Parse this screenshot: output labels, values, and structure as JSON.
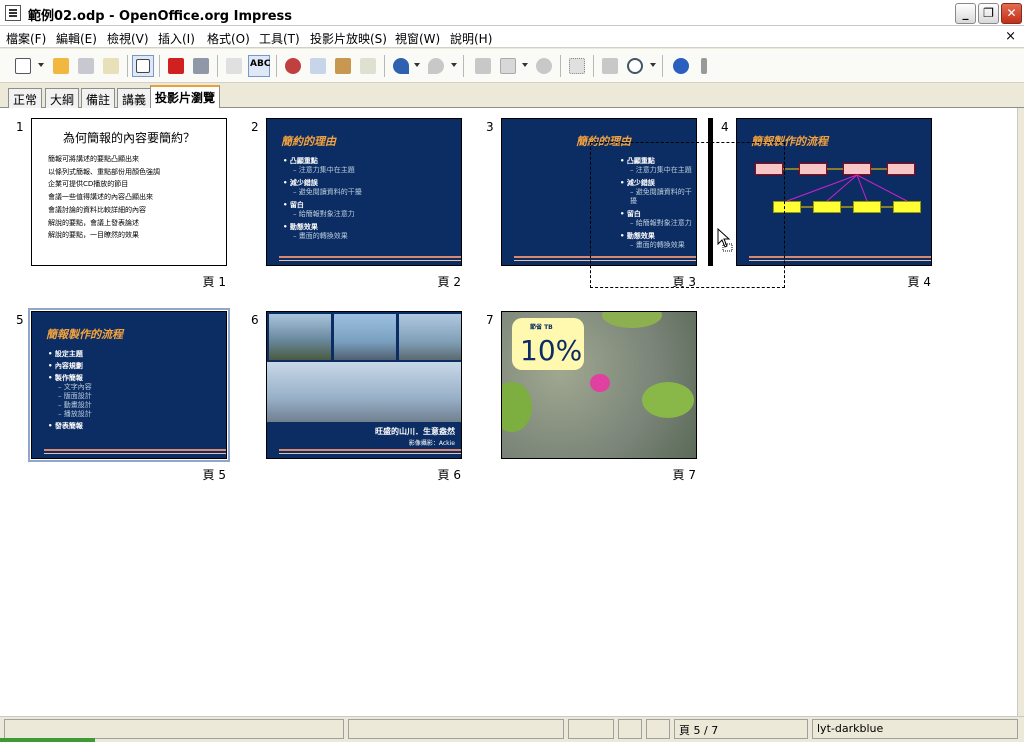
{
  "window": {
    "title": "範例02.odp - OpenOffice.org Impress",
    "minimize": "_",
    "maximize": "❐",
    "close": "✕"
  },
  "menu": {
    "items": [
      "檔案(F)",
      "編輯(E)",
      "檢視(V)",
      "插入(I)",
      "格式(O)",
      "工具(T)",
      "投影片放映(S)",
      "視窗(W)",
      "說明(H)"
    ],
    "doc_close": "×"
  },
  "toolbar": {
    "icons": [
      "new-icon",
      "open-icon",
      "save-icon",
      "email-icon",
      "edit-file-icon",
      "pdf-icon",
      "print-icon",
      "spellcheck-icon",
      "autospell-icon",
      "cut-icon",
      "copy-icon",
      "paste-icon",
      "clone-format-icon",
      "undo-icon",
      "redo-icon",
      "chart-icon",
      "table-icon",
      "globe-icon",
      "grid-icon",
      "draw-icon",
      "zoom-icon",
      "help-icon"
    ],
    "abc_label": "ABC"
  },
  "tabs": [
    "正常",
    "大綱",
    "備註",
    "講義",
    "投影片瀏覽"
  ],
  "slides": [
    {
      "num": "1",
      "page": "頁 1",
      "title": "為何簡報的內容要簡約？",
      "lines": [
        "簡報可將講述的要點凸顯出來",
        "以條列式簡報、重點部份用顏色強調",
        "企業可提供CD播放的節目",
        "會議一些值得講述的內容凸顯出來",
        "會議討論的資料比較詳細的內容",
        "解說的要點，會議上發表論述",
        "解說的要點，一目瞭然的效果"
      ]
    },
    {
      "num": "2",
      "page": "頁 2",
      "title": "簡約的理由",
      "bullets": [
        {
          "t": "凸顯重點",
          "s": "注意力集中在主題"
        },
        {
          "t": "減少錯誤",
          "s": "避免閱讀資料的干擾"
        },
        {
          "t": "留白",
          "s": "給簡報對象注意力"
        },
        {
          "t": "動態效果",
          "s": "畫面的轉換效果"
        }
      ]
    },
    {
      "num": "3",
      "page": "頁 3",
      "title": "簡約的理由",
      "bullets": [
        {
          "t": "凸顯重點",
          "s": "注意力集中在主題"
        },
        {
          "t": "減少錯誤",
          "s": "避免閱讀資料的干擾"
        },
        {
          "t": "留白",
          "s": "給簡報對象注意力"
        },
        {
          "t": "動態效果",
          "s": "畫面的轉換效果"
        }
      ]
    },
    {
      "num": "4",
      "page": "頁 4",
      "title": "簡報製作的流程"
    },
    {
      "num": "5",
      "page": "頁 5",
      "title": "簡報製作的流程",
      "bullets": [
        {
          "t": "設定主題",
          "s": ""
        },
        {
          "t": "內容規劃",
          "s": ""
        },
        {
          "t": "製作簡報",
          "subs": [
            "文字內容",
            "版面設計",
            "動畫設計",
            "播放設計"
          ]
        },
        {
          "t": "發表簡報",
          "s": ""
        }
      ]
    },
    {
      "num": "6",
      "page": "頁 6",
      "caption": "旺盛的山川．生意盎然",
      "credit": "影像攝影：Ackie"
    },
    {
      "num": "7",
      "page": "頁 7",
      "sticky_small": "節省 TB",
      "sticky_pct": "10%"
    }
  ],
  "status": {
    "page": "頁 5 / 7",
    "layout": "lyt-darkblue"
  },
  "colors": {
    "slide_bg": "#0b2d63",
    "title_orange": "#f3a23e",
    "accent_tab": "#e8a23a"
  }
}
